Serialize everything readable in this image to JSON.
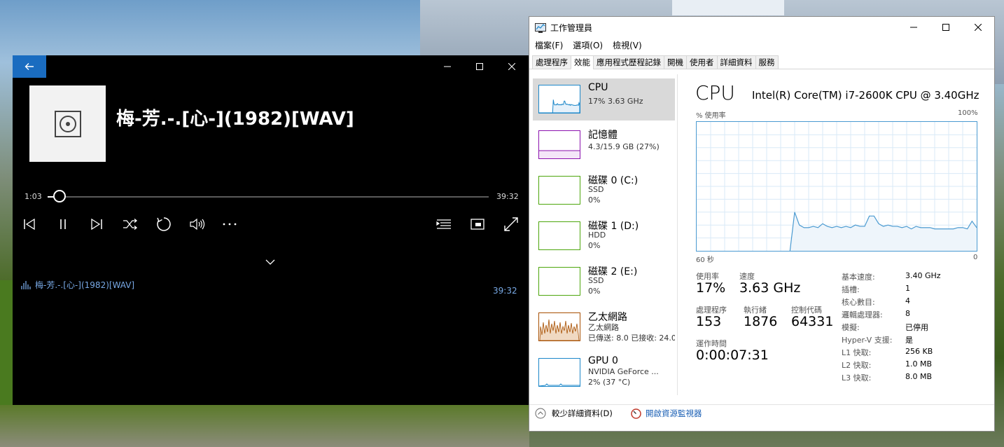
{
  "player": {
    "song_title": "梅-芳.-.[心-](1982)[WAV]",
    "time_current": "1:03",
    "time_total": "39:32",
    "progress_fraction": 0.027,
    "queue_item_title": "梅-芳.-.[心-](1982)[WAV]",
    "queue_item_duration": "39:32",
    "accent_color": "#1a6cc0",
    "queue_text_color": "#78a9e6",
    "icons": {
      "back": "back-arrow-icon",
      "album": "music-disc-icon",
      "previous": "previous-track-icon",
      "pause": "pause-icon",
      "next": "next-track-icon",
      "shuffle": "shuffle-icon",
      "repeat": "repeat-icon",
      "volume": "volume-icon",
      "more": "more-icon",
      "playlist": "playlist-icon",
      "mini": "mini-view-icon",
      "fullscreen": "fullscreen-icon",
      "collapse": "chevron-down-icon",
      "now_playing": "equalizer-icon"
    }
  },
  "taskmgr": {
    "title": "工作管理員",
    "menus": [
      "檔案(F)",
      "選項(O)",
      "檢視(V)"
    ],
    "tabs": [
      "處理程序",
      "效能",
      "應用程式歷程記錄",
      "開機",
      "使用者",
      "詳細資料",
      "服務"
    ],
    "active_tab": "效能",
    "sidebar": [
      {
        "name": "CPU",
        "line1": "17%  3.63 GHz",
        "line2": "",
        "color": "#1b87c9"
      },
      {
        "name": "記憶體",
        "line1": "4.3/15.9 GB (27%)",
        "line2": "",
        "color": "#8b12ae"
      },
      {
        "name": "磁碟 0 (C:)",
        "line1": "SSD",
        "line2": "0%",
        "color": "#4da60c"
      },
      {
        "name": "磁碟 1 (D:)",
        "line1": "HDD",
        "line2": "0%",
        "color": "#4da60c"
      },
      {
        "name": "磁碟 2 (E:)",
        "line1": "SSD",
        "line2": "0%",
        "color": "#4da60c"
      },
      {
        "name": "乙太網路",
        "line1": "乙太網路",
        "line2": "已傳送: 8.0  已接收: 24.0",
        "color": "#a74f01"
      },
      {
        "name": "GPU 0",
        "line1": "NVIDIA GeForce ...",
        "line2": "2%  (37 °C)",
        "color": "#1b87c9"
      }
    ],
    "cpu": {
      "heading": "CPU",
      "model": "Intel(R) Core(TM) i7-2600K CPU @ 3.40GHz",
      "graph_ylabel": "% 使用率",
      "graph_ymax": "100%",
      "graph_xleft": "60 秒",
      "graph_xright": "0",
      "graph_color": "#4a9ad1",
      "graph_fill": "#eef5fb",
      "utilization_history": [
        0,
        0,
        0,
        0,
        0,
        0,
        0,
        0,
        0,
        0,
        0,
        0,
        0,
        0,
        0,
        0,
        0,
        0,
        0,
        0,
        0,
        30,
        20,
        18,
        18,
        19,
        18,
        21,
        19,
        18,
        19,
        18,
        19,
        18,
        20,
        19,
        19,
        27,
        27,
        21,
        19,
        20,
        19,
        19,
        18,
        19,
        17,
        19,
        18,
        18,
        18,
        17,
        17,
        17,
        17,
        17,
        18,
        18,
        17,
        23,
        18
      ],
      "stats": {
        "util_label": "使用率",
        "util_value": "17%",
        "speed_label": "速度",
        "speed_value": "3.63 GHz",
        "proc_label": "處理程序",
        "proc_value": "153",
        "threads_label": "執行緒",
        "threads_value": "1876",
        "handles_label": "控制代碼",
        "handles_value": "64331",
        "uptime_label": "運作時間",
        "uptime_value": "0:00:07:31"
      },
      "specs": [
        {
          "k": "基本速度:",
          "v": "3.40 GHz"
        },
        {
          "k": "插槽:",
          "v": "1"
        },
        {
          "k": "核心數目:",
          "v": "4"
        },
        {
          "k": "邏輯處理器:",
          "v": "8"
        },
        {
          "k": "模擬:",
          "v": "已停用"
        },
        {
          "k": "Hyper-V 支援:",
          "v": "是"
        },
        {
          "k": "L1 快取:",
          "v": "256 KB"
        },
        {
          "k": "L2 快取:",
          "v": "1.0 MB"
        },
        {
          "k": "L3 快取:",
          "v": "8.0 MB"
        }
      ]
    },
    "footer": {
      "fewer_details": "較少詳細資料(D)",
      "open_resmon": "開啟資源監視器"
    }
  }
}
